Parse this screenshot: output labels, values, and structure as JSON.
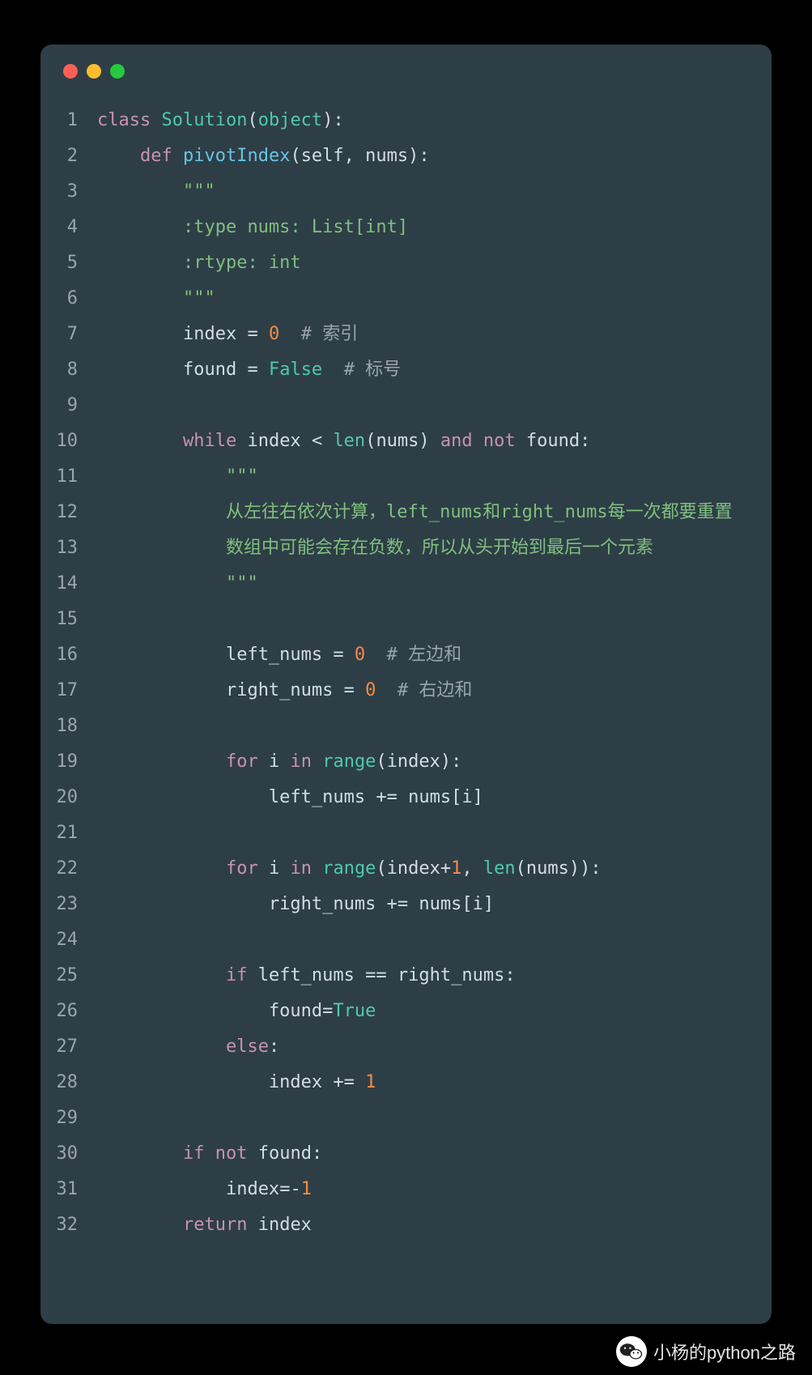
{
  "window": {
    "traffic_lights": [
      "close",
      "minimize",
      "zoom"
    ]
  },
  "code": {
    "lines": [
      {
        "n": 1,
        "indent": 0,
        "tokens": [
          [
            "kw",
            "class"
          ],
          [
            "sp",
            " "
          ],
          [
            "cls",
            "Solution"
          ],
          [
            "op",
            "("
          ],
          [
            "builtin",
            "object"
          ],
          [
            "op",
            ")"
          ],
          [
            "op",
            ":"
          ]
        ]
      },
      {
        "n": 2,
        "indent": 1,
        "tokens": [
          [
            "kw",
            "def"
          ],
          [
            "sp",
            " "
          ],
          [
            "fn",
            "pivotIndex"
          ],
          [
            "op",
            "("
          ],
          [
            "ident",
            "self"
          ],
          [
            "op",
            ","
          ],
          [
            "sp",
            " "
          ],
          [
            "ident",
            "nums"
          ],
          [
            "op",
            ")"
          ],
          [
            "op",
            ":"
          ]
        ]
      },
      {
        "n": 3,
        "indent": 2,
        "tokens": [
          [
            "str",
            "\"\"\""
          ]
        ]
      },
      {
        "n": 4,
        "indent": 2,
        "tokens": [
          [
            "str",
            ":type nums: List[int]"
          ]
        ]
      },
      {
        "n": 5,
        "indent": 2,
        "tokens": [
          [
            "str",
            ":rtype: int"
          ]
        ]
      },
      {
        "n": 6,
        "indent": 2,
        "tokens": [
          [
            "str",
            "\"\"\""
          ]
        ]
      },
      {
        "n": 7,
        "indent": 2,
        "tokens": [
          [
            "ident",
            "index"
          ],
          [
            "sp",
            " "
          ],
          [
            "op",
            "="
          ],
          [
            "sp",
            " "
          ],
          [
            "num",
            "0"
          ],
          [
            "sp",
            "  "
          ],
          [
            "comment",
            "# 索引"
          ]
        ]
      },
      {
        "n": 8,
        "indent": 2,
        "tokens": [
          [
            "ident",
            "found"
          ],
          [
            "sp",
            " "
          ],
          [
            "op",
            "="
          ],
          [
            "sp",
            " "
          ],
          [
            "bool",
            "False"
          ],
          [
            "sp",
            "  "
          ],
          [
            "comment",
            "# 标号"
          ]
        ]
      },
      {
        "n": 9,
        "indent": 0,
        "tokens": []
      },
      {
        "n": 10,
        "indent": 2,
        "tokens": [
          [
            "kw",
            "while"
          ],
          [
            "sp",
            " "
          ],
          [
            "ident",
            "index"
          ],
          [
            "sp",
            " "
          ],
          [
            "op",
            "<"
          ],
          [
            "sp",
            " "
          ],
          [
            "builtin",
            "len"
          ],
          [
            "op",
            "("
          ],
          [
            "ident",
            "nums"
          ],
          [
            "op",
            ")"
          ],
          [
            "sp",
            " "
          ],
          [
            "kw",
            "and"
          ],
          [
            "sp",
            " "
          ],
          [
            "kw",
            "not"
          ],
          [
            "sp",
            " "
          ],
          [
            "ident",
            "found"
          ],
          [
            "op",
            ":"
          ]
        ]
      },
      {
        "n": 11,
        "indent": 3,
        "tokens": [
          [
            "str",
            "\"\"\""
          ]
        ]
      },
      {
        "n": 12,
        "indent": 3,
        "wrap_indent": 0,
        "tokens": [
          [
            "str",
            "从左往右依次计算，left_nums和right_nums每一次都要重置"
          ]
        ]
      },
      {
        "n": 13,
        "indent": 3,
        "wrap_indent": 0,
        "tokens": [
          [
            "str",
            "数组中可能会存在负数，所以从头开始到最后一个元素"
          ]
        ]
      },
      {
        "n": 14,
        "indent": 3,
        "tokens": [
          [
            "str",
            "\"\"\""
          ]
        ]
      },
      {
        "n": 15,
        "indent": 0,
        "tokens": []
      },
      {
        "n": 16,
        "indent": 3,
        "tokens": [
          [
            "ident",
            "left_nums"
          ],
          [
            "sp",
            " "
          ],
          [
            "op",
            "="
          ],
          [
            "sp",
            " "
          ],
          [
            "num",
            "0"
          ],
          [
            "sp",
            "  "
          ],
          [
            "comment",
            "# 左边和"
          ]
        ]
      },
      {
        "n": 17,
        "indent": 3,
        "tokens": [
          [
            "ident",
            "right_nums"
          ],
          [
            "sp",
            " "
          ],
          [
            "op",
            "="
          ],
          [
            "sp",
            " "
          ],
          [
            "num",
            "0"
          ],
          [
            "sp",
            "  "
          ],
          [
            "comment",
            "# 右边和"
          ]
        ]
      },
      {
        "n": 18,
        "indent": 0,
        "tokens": []
      },
      {
        "n": 19,
        "indent": 3,
        "tokens": [
          [
            "kw",
            "for"
          ],
          [
            "sp",
            " "
          ],
          [
            "ident",
            "i"
          ],
          [
            "sp",
            " "
          ],
          [
            "kw",
            "in"
          ],
          [
            "sp",
            " "
          ],
          [
            "builtin",
            "range"
          ],
          [
            "op",
            "("
          ],
          [
            "ident",
            "index"
          ],
          [
            "op",
            ")"
          ],
          [
            "op",
            ":"
          ]
        ]
      },
      {
        "n": 20,
        "indent": 4,
        "tokens": [
          [
            "ident",
            "left_nums"
          ],
          [
            "sp",
            " "
          ],
          [
            "op",
            "+="
          ],
          [
            "sp",
            " "
          ],
          [
            "ident",
            "nums"
          ],
          [
            "op",
            "["
          ],
          [
            "ident",
            "i"
          ],
          [
            "op",
            "]"
          ]
        ]
      },
      {
        "n": 21,
        "indent": 0,
        "tokens": []
      },
      {
        "n": 22,
        "indent": 3,
        "tokens": [
          [
            "kw",
            "for"
          ],
          [
            "sp",
            " "
          ],
          [
            "ident",
            "i"
          ],
          [
            "sp",
            " "
          ],
          [
            "kw",
            "in"
          ],
          [
            "sp",
            " "
          ],
          [
            "builtin",
            "range"
          ],
          [
            "op",
            "("
          ],
          [
            "ident",
            "index"
          ],
          [
            "op",
            "+"
          ],
          [
            "num",
            "1"
          ],
          [
            "op",
            ","
          ],
          [
            "sp",
            " "
          ],
          [
            "builtin",
            "len"
          ],
          [
            "op",
            "("
          ],
          [
            "ident",
            "nums"
          ],
          [
            "op",
            ")"
          ],
          [
            "op",
            ")"
          ],
          [
            "op",
            ":"
          ]
        ]
      },
      {
        "n": 23,
        "indent": 4,
        "tokens": [
          [
            "ident",
            "right_nums"
          ],
          [
            "sp",
            " "
          ],
          [
            "op",
            "+="
          ],
          [
            "sp",
            " "
          ],
          [
            "ident",
            "nums"
          ],
          [
            "op",
            "["
          ],
          [
            "ident",
            "i"
          ],
          [
            "op",
            "]"
          ]
        ]
      },
      {
        "n": 24,
        "indent": 0,
        "tokens": []
      },
      {
        "n": 25,
        "indent": 3,
        "tokens": [
          [
            "kw",
            "if"
          ],
          [
            "sp",
            " "
          ],
          [
            "ident",
            "left_nums"
          ],
          [
            "sp",
            " "
          ],
          [
            "op",
            "=="
          ],
          [
            "sp",
            " "
          ],
          [
            "ident",
            "right_nums"
          ],
          [
            "op",
            ":"
          ]
        ]
      },
      {
        "n": 26,
        "indent": 4,
        "tokens": [
          [
            "ident",
            "found"
          ],
          [
            "op",
            "="
          ],
          [
            "bool",
            "True"
          ]
        ]
      },
      {
        "n": 27,
        "indent": 3,
        "tokens": [
          [
            "kw",
            "else"
          ],
          [
            "op",
            ":"
          ]
        ]
      },
      {
        "n": 28,
        "indent": 4,
        "tokens": [
          [
            "ident",
            "index"
          ],
          [
            "sp",
            " "
          ],
          [
            "op",
            "+="
          ],
          [
            "sp",
            " "
          ],
          [
            "num",
            "1"
          ]
        ]
      },
      {
        "n": 29,
        "indent": 0,
        "tokens": []
      },
      {
        "n": 30,
        "indent": 2,
        "tokens": [
          [
            "kw",
            "if"
          ],
          [
            "sp",
            " "
          ],
          [
            "kw",
            "not"
          ],
          [
            "sp",
            " "
          ],
          [
            "ident",
            "found"
          ],
          [
            "op",
            ":"
          ]
        ]
      },
      {
        "n": 31,
        "indent": 3,
        "tokens": [
          [
            "ident",
            "index"
          ],
          [
            "op",
            "="
          ],
          [
            "op",
            "-"
          ],
          [
            "num",
            "1"
          ]
        ]
      },
      {
        "n": 32,
        "indent": 2,
        "tokens": [
          [
            "kw",
            "return"
          ],
          [
            "sp",
            " "
          ],
          [
            "ident",
            "index"
          ]
        ]
      }
    ]
  },
  "footer": {
    "text": "小杨的python之路"
  },
  "colors": {
    "bg": "#000000",
    "window_bg": "#2e3e46",
    "keyword": "#c792b0",
    "builtin": "#4ec9b0",
    "function": "#66c4e6",
    "identifier": "#d2dde4",
    "number": "#f08d49",
    "string": "#7fbf7f",
    "comment": "#9aa5ac",
    "gutter": "#9aa5ac"
  }
}
